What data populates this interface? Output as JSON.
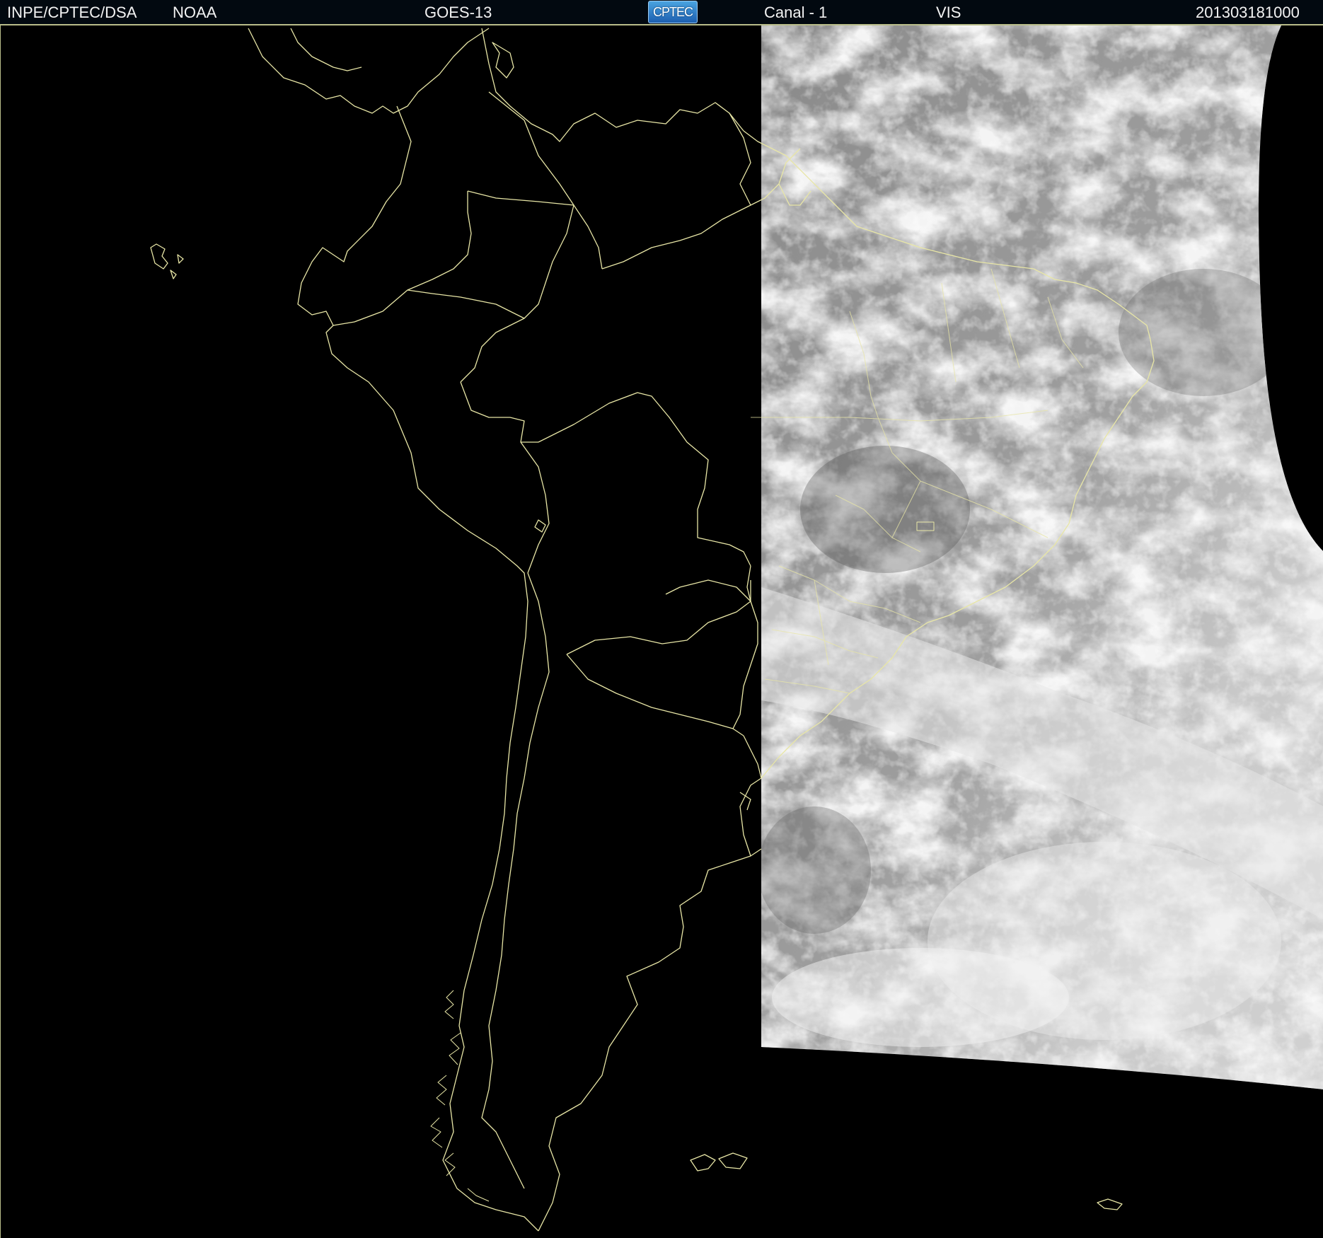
{
  "header": {
    "institution": "INPE/CPTEC/DSA",
    "agency": "NOAA",
    "satellite": "GOES-13",
    "logo_text": "CPTEC",
    "channel": "Canal - 1",
    "band": "VIS",
    "timestamp": "201303181000"
  },
  "colors": {
    "header_background": "#020910",
    "header_text": "#f3f3f3",
    "border_lines": "#e8e6a6",
    "space_background": "#000000",
    "cloud_imagery": "#9a9a9a"
  },
  "map": {
    "region": "South America",
    "projection_extent": "satellite visible image, daylit eastern half",
    "icons": [
      "cptec-logo-icon"
    ]
  }
}
